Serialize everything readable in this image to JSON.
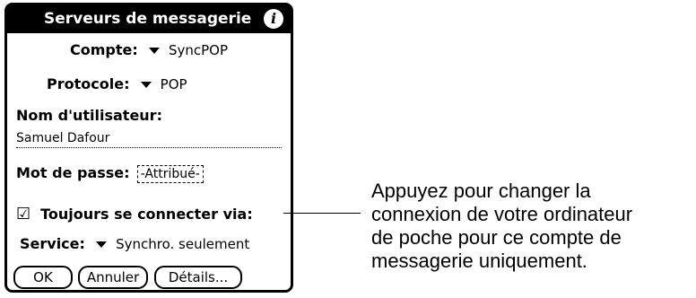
{
  "window": {
    "title": "Serveurs de messagerie",
    "info_icon": "i"
  },
  "account": {
    "label": "Compte:",
    "value": "SyncPOP"
  },
  "protocol": {
    "label": "Protocole:",
    "value": "POP"
  },
  "username": {
    "label": "Nom d'utilisateur:",
    "value": "Samuel Dafour"
  },
  "password": {
    "label": "Mot de passe:",
    "value": "-Attribué-"
  },
  "always_connect": {
    "label": "Toujours se connecter via:",
    "checked": true,
    "check_glyph": "☑"
  },
  "service": {
    "label": "Service:",
    "value": "Synchro. seulement"
  },
  "buttons": {
    "ok": "OK",
    "cancel": "Annuler",
    "details": "Détails..."
  },
  "callout": {
    "lines": [
      "Appuyez pour changer la",
      "connexion de votre ordinateur",
      "de poche pour ce compte de",
      "messagerie uniquement."
    ]
  }
}
